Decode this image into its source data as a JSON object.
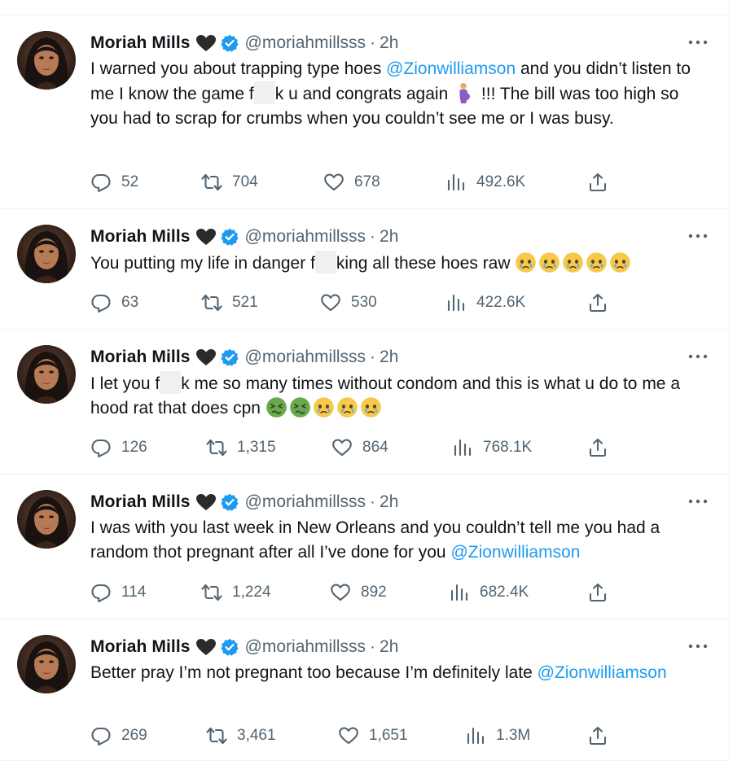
{
  "author": {
    "name": "Moriah Mills",
    "handle": "@moriahmillsss",
    "dot": "·",
    "verified": true,
    "heart_emoji": "black-heart",
    "colors": {
      "verified": "#1d9bf0",
      "muted": "#536471",
      "link": "#1d9bf0"
    }
  },
  "tweets": [
    {
      "time": "2h",
      "segments": [
        {
          "t": "text",
          "v": "I warned you about trapping type hoes "
        },
        {
          "t": "mention",
          "v": "@Zionwilliamson"
        },
        {
          "t": "text",
          "v": " and you didn’t listen to me I know the game f"
        },
        {
          "t": "redact"
        },
        {
          "t": "text",
          "v": "k u and congrats again "
        },
        {
          "t": "emoji",
          "v": "pregnant-woman"
        },
        {
          "t": "text",
          "v": " !!! The bill was too high so you had to scrap for crumbs when you couldn’t see me or I was busy."
        }
      ],
      "stats": {
        "replies": "52",
        "retweets": "704",
        "likes": "678",
        "views": "492.6K"
      }
    },
    {
      "time": "2h",
      "segments": [
        {
          "t": "text",
          "v": "You putting my life in danger f"
        },
        {
          "t": "redact"
        },
        {
          "t": "text",
          "v": "king all these hoes raw "
        },
        {
          "t": "emoji",
          "v": "holding-back-tears"
        },
        {
          "t": "emoji",
          "v": "holding-back-tears"
        },
        {
          "t": "emoji",
          "v": "holding-back-tears"
        },
        {
          "t": "emoji",
          "v": "holding-back-tears"
        },
        {
          "t": "emoji",
          "v": "holding-back-tears"
        }
      ],
      "stats": {
        "replies": "63",
        "retweets": "521",
        "likes": "530",
        "views": "422.6K"
      }
    },
    {
      "time": "2h",
      "segments": [
        {
          "t": "text",
          "v": "I let you f"
        },
        {
          "t": "redact"
        },
        {
          "t": "text",
          "v": "k me so many times without condom and this is what u do to me a hood rat that does cpn "
        },
        {
          "t": "emoji",
          "v": "nauseated-face"
        },
        {
          "t": "emoji",
          "v": "nauseated-face"
        },
        {
          "t": "emoji",
          "v": "holding-back-tears"
        },
        {
          "t": "emoji",
          "v": "holding-back-tears"
        },
        {
          "t": "emoji",
          "v": "holding-back-tears"
        }
      ],
      "stats": {
        "replies": "126",
        "retweets": "1,315",
        "likes": "864",
        "views": "768.1K"
      }
    },
    {
      "time": "2h",
      "segments": [
        {
          "t": "text",
          "v": "I was with you last week in New Orleans and you couldn’t tell me you had a random thot pregnant after all I’ve done for you "
        },
        {
          "t": "mention",
          "v": "@Zionwilliamson"
        }
      ],
      "stats": {
        "replies": "114",
        "retweets": "1,224",
        "likes": "892",
        "views": "682.4K"
      }
    },
    {
      "time": "2h",
      "segments": [
        {
          "t": "text",
          "v": "Better pray I’m not pregnant too because I’m definitely late "
        },
        {
          "t": "mention",
          "v": "@Zionwilliamson"
        }
      ],
      "stats": {
        "replies": "269",
        "retweets": "3,461",
        "likes": "1,651",
        "views": "1.3M"
      }
    }
  ]
}
